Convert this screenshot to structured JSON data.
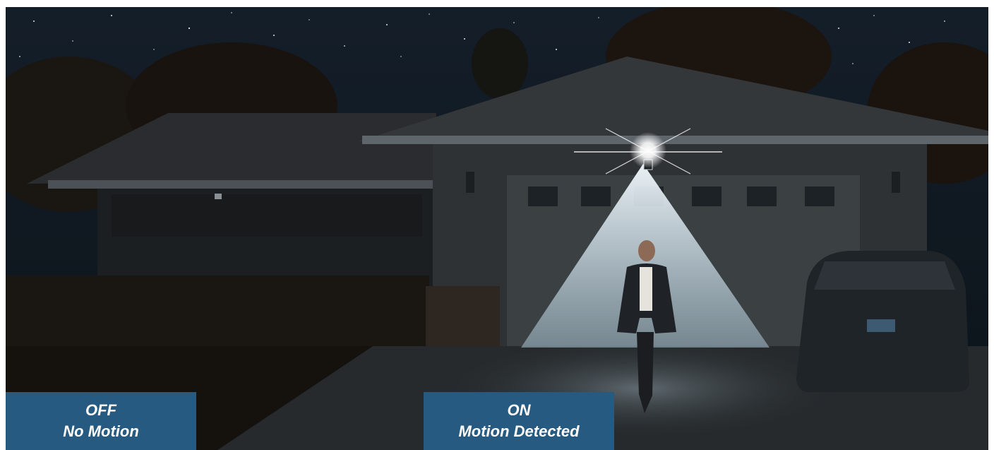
{
  "labels": {
    "off": {
      "state": "OFF",
      "caption": "No Motion"
    },
    "on": {
      "state": "ON",
      "caption": "Motion Detected"
    }
  },
  "colors": {
    "label_bg": "#265a80",
    "label_text": "#ffffff",
    "sky": "#0b1520",
    "light_cone": "#dfe9ef"
  }
}
